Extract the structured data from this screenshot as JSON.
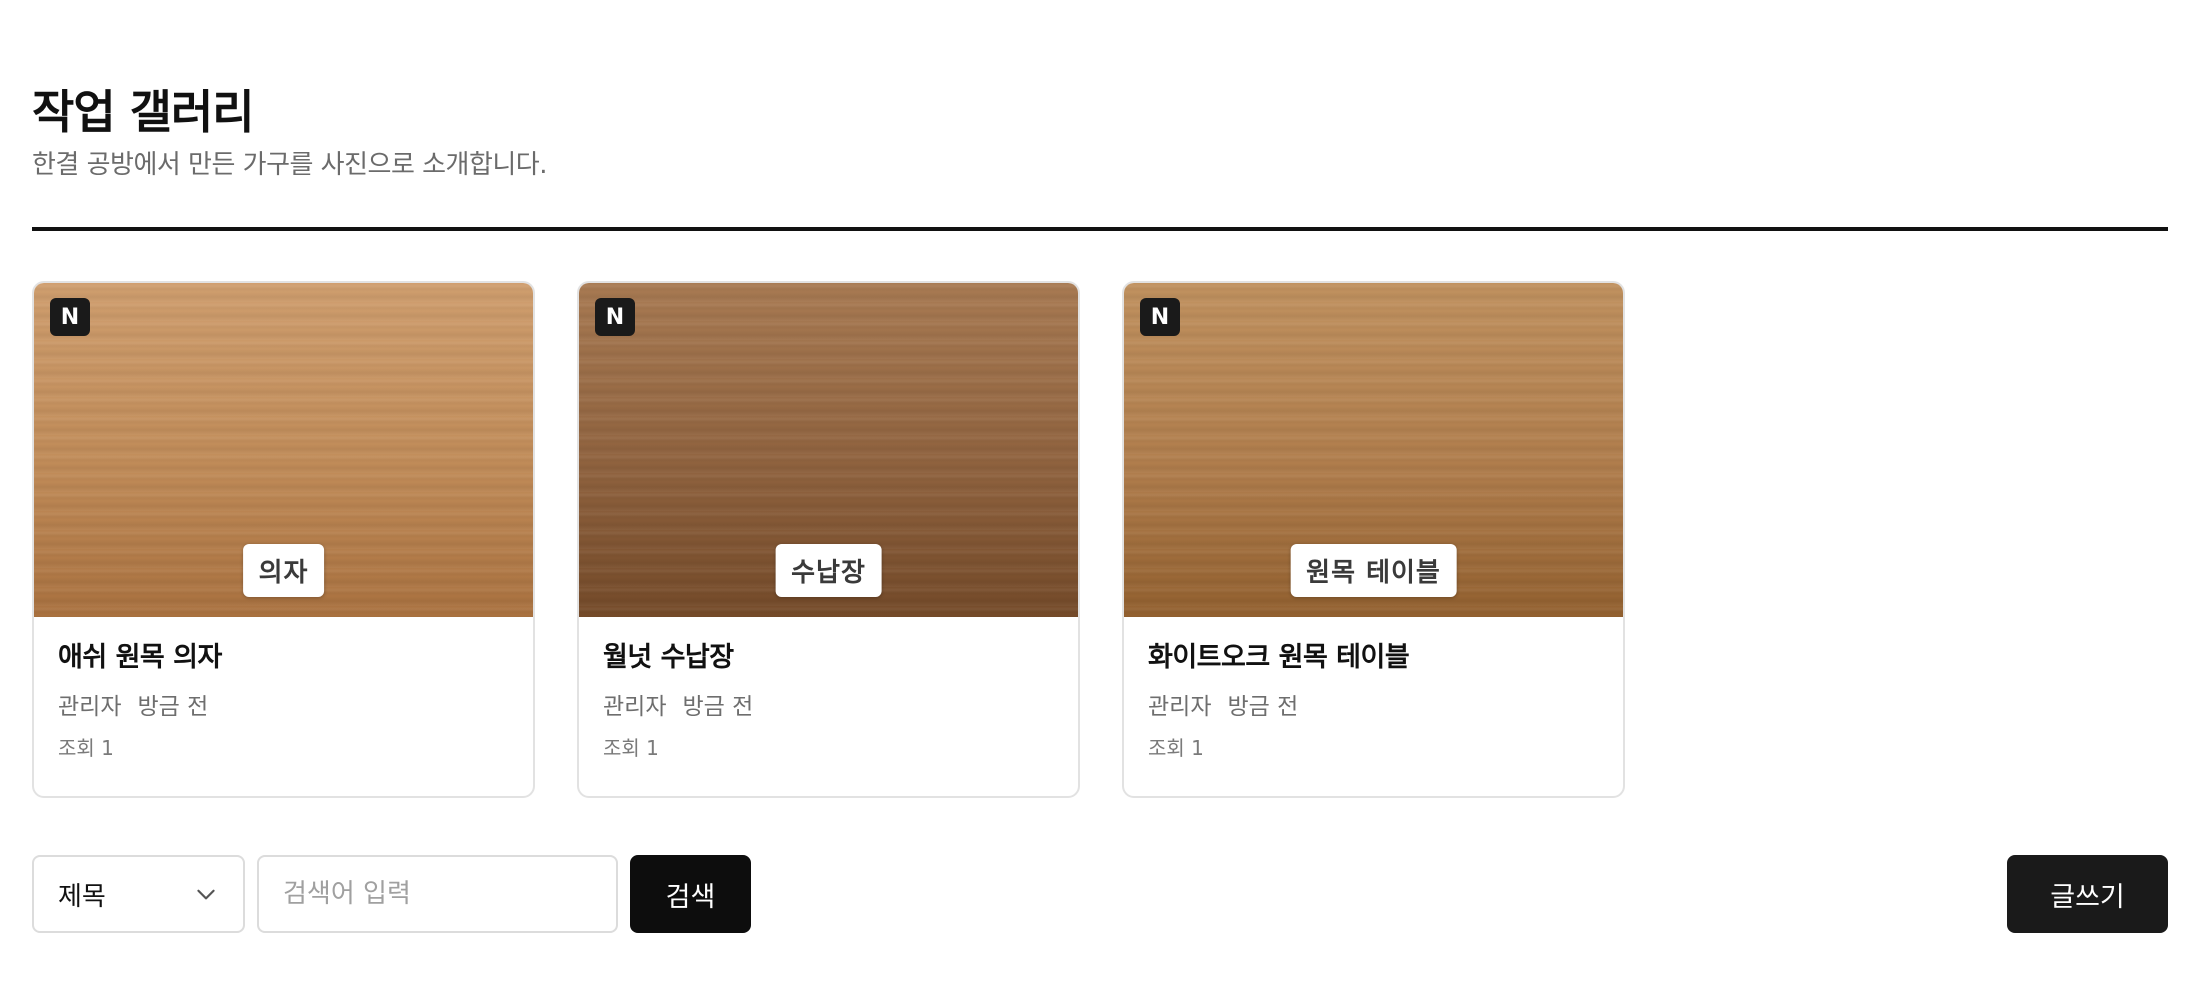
{
  "header": {
    "title": "작업 갤러리",
    "subtitle": "한결 공방에서 만든 가구를 사진으로 소개합니다."
  },
  "gallery": {
    "items": [
      {
        "badge": "N",
        "image_label": "의자",
        "title": "애쉬 원목 의자",
        "author": "관리자",
        "time": "방금 전",
        "views": "조회 1"
      },
      {
        "badge": "N",
        "image_label": "수납장",
        "title": "월넛 수납장",
        "author": "관리자",
        "time": "방금 전",
        "views": "조회 1"
      },
      {
        "badge": "N",
        "image_label": "원목 테이블",
        "title": "화이트오크 원목 테이블",
        "author": "관리자",
        "time": "방금 전",
        "views": "조회 1"
      }
    ]
  },
  "search": {
    "field_select": "제목",
    "field_icon": "chevron-down-icon",
    "placeholder": "검색어 입력",
    "button_label": "검색"
  },
  "actions": {
    "write_label": "글쓰기"
  },
  "colors": {
    "accent": "#111111",
    "muted_text": "#6b6b6b",
    "border": "#e2e2e2"
  }
}
